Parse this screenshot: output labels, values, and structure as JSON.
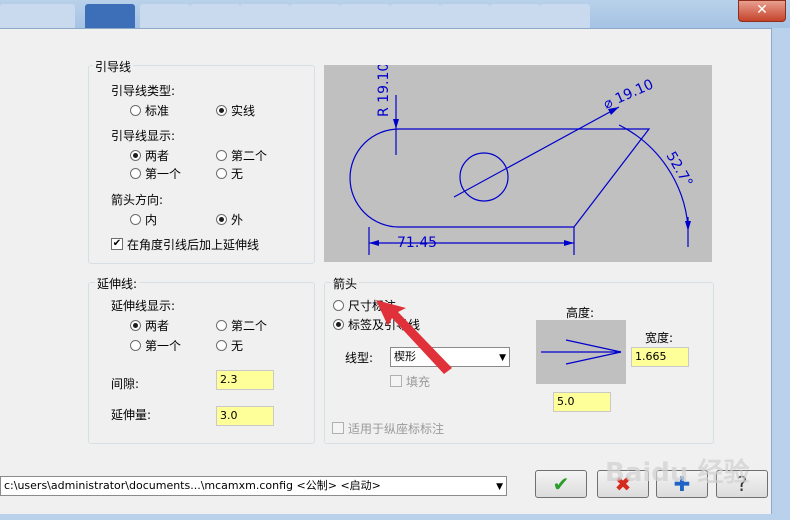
{
  "window": {
    "tabs": [
      "",
      "",
      "",
      "",
      "",
      "",
      "",
      "",
      "",
      "",
      ""
    ],
    "close_label": "✕"
  },
  "leader": {
    "group_title": "引导线",
    "type_label": "引导线类型:",
    "type_options": [
      "标准",
      "实线"
    ],
    "display_label": "引导线显示:",
    "display_options": [
      "两者",
      "第二个",
      "第一个",
      "无"
    ],
    "arrow_dir_label": "箭头方向:",
    "arrow_dir_options": [
      "内",
      "外"
    ],
    "extend_checkbox": "在角度引线后加上延伸线"
  },
  "extension": {
    "group_title": "延伸线:",
    "display_label": "延伸线显示:",
    "display_options": [
      "两者",
      "第二个",
      "第一个",
      "无"
    ],
    "gap_label": "间隙:",
    "gap_value": "2.3",
    "extend_label": "延伸量:",
    "extend_value": "3.0"
  },
  "arrow": {
    "group_title": "箭头",
    "option_dimension": "尺寸标注",
    "option_label_leader": "标签及引导线",
    "linetype_label": "线型:",
    "linetype_value": "楔形",
    "fill_label": "填充",
    "height_label": "高度:",
    "height_value": "5.0",
    "width_label": "宽度:",
    "width_value": "1.665",
    "ordinate_label": "适用于纵座标标注"
  },
  "preview": {
    "dim_radius": "R 19.10",
    "dim_diameter": "⌀ 19.10",
    "dim_angle": "52.7°",
    "dim_linear": "71.45"
  },
  "footer": {
    "config_path": "c:\\users\\administrator\\documents...\\mcamxm.config <公制> <启动>"
  },
  "watermark": "Baidu 经验",
  "colors": {
    "accent_blue": "#0000cc",
    "input_yellow": "#ffff99",
    "annotation_red": "#e0303a"
  }
}
